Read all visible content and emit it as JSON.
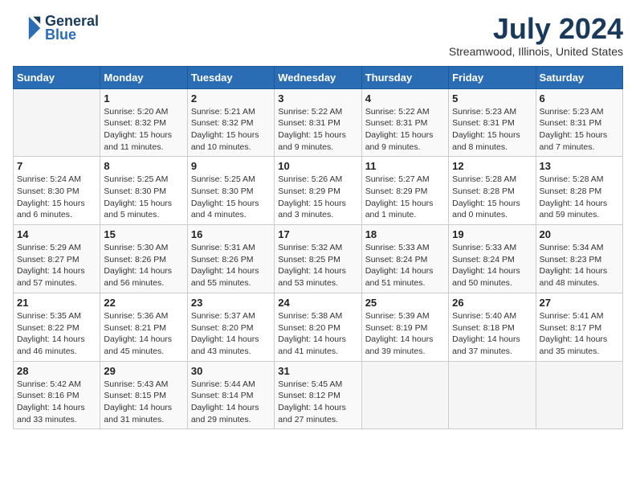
{
  "header": {
    "logo_line1": "General",
    "logo_line2": "Blue",
    "month_year": "July 2024",
    "location": "Streamwood, Illinois, United States"
  },
  "weekdays": [
    "Sunday",
    "Monday",
    "Tuesday",
    "Wednesday",
    "Thursday",
    "Friday",
    "Saturday"
  ],
  "weeks": [
    [
      {
        "day": "",
        "info": ""
      },
      {
        "day": "1",
        "info": "Sunrise: 5:20 AM\nSunset: 8:32 PM\nDaylight: 15 hours\nand 11 minutes."
      },
      {
        "day": "2",
        "info": "Sunrise: 5:21 AM\nSunset: 8:32 PM\nDaylight: 15 hours\nand 10 minutes."
      },
      {
        "day": "3",
        "info": "Sunrise: 5:22 AM\nSunset: 8:31 PM\nDaylight: 15 hours\nand 9 minutes."
      },
      {
        "day": "4",
        "info": "Sunrise: 5:22 AM\nSunset: 8:31 PM\nDaylight: 15 hours\nand 9 minutes."
      },
      {
        "day": "5",
        "info": "Sunrise: 5:23 AM\nSunset: 8:31 PM\nDaylight: 15 hours\nand 8 minutes."
      },
      {
        "day": "6",
        "info": "Sunrise: 5:23 AM\nSunset: 8:31 PM\nDaylight: 15 hours\nand 7 minutes."
      }
    ],
    [
      {
        "day": "7",
        "info": "Sunrise: 5:24 AM\nSunset: 8:30 PM\nDaylight: 15 hours\nand 6 minutes."
      },
      {
        "day": "8",
        "info": "Sunrise: 5:25 AM\nSunset: 8:30 PM\nDaylight: 15 hours\nand 5 minutes."
      },
      {
        "day": "9",
        "info": "Sunrise: 5:25 AM\nSunset: 8:30 PM\nDaylight: 15 hours\nand 4 minutes."
      },
      {
        "day": "10",
        "info": "Sunrise: 5:26 AM\nSunset: 8:29 PM\nDaylight: 15 hours\nand 3 minutes."
      },
      {
        "day": "11",
        "info": "Sunrise: 5:27 AM\nSunset: 8:29 PM\nDaylight: 15 hours\nand 1 minute."
      },
      {
        "day": "12",
        "info": "Sunrise: 5:28 AM\nSunset: 8:28 PM\nDaylight: 15 hours\nand 0 minutes."
      },
      {
        "day": "13",
        "info": "Sunrise: 5:28 AM\nSunset: 8:28 PM\nDaylight: 14 hours\nand 59 minutes."
      }
    ],
    [
      {
        "day": "14",
        "info": "Sunrise: 5:29 AM\nSunset: 8:27 PM\nDaylight: 14 hours\nand 57 minutes."
      },
      {
        "day": "15",
        "info": "Sunrise: 5:30 AM\nSunset: 8:26 PM\nDaylight: 14 hours\nand 56 minutes."
      },
      {
        "day": "16",
        "info": "Sunrise: 5:31 AM\nSunset: 8:26 PM\nDaylight: 14 hours\nand 55 minutes."
      },
      {
        "day": "17",
        "info": "Sunrise: 5:32 AM\nSunset: 8:25 PM\nDaylight: 14 hours\nand 53 minutes."
      },
      {
        "day": "18",
        "info": "Sunrise: 5:33 AM\nSunset: 8:24 PM\nDaylight: 14 hours\nand 51 minutes."
      },
      {
        "day": "19",
        "info": "Sunrise: 5:33 AM\nSunset: 8:24 PM\nDaylight: 14 hours\nand 50 minutes."
      },
      {
        "day": "20",
        "info": "Sunrise: 5:34 AM\nSunset: 8:23 PM\nDaylight: 14 hours\nand 48 minutes."
      }
    ],
    [
      {
        "day": "21",
        "info": "Sunrise: 5:35 AM\nSunset: 8:22 PM\nDaylight: 14 hours\nand 46 minutes."
      },
      {
        "day": "22",
        "info": "Sunrise: 5:36 AM\nSunset: 8:21 PM\nDaylight: 14 hours\nand 45 minutes."
      },
      {
        "day": "23",
        "info": "Sunrise: 5:37 AM\nSunset: 8:20 PM\nDaylight: 14 hours\nand 43 minutes."
      },
      {
        "day": "24",
        "info": "Sunrise: 5:38 AM\nSunset: 8:20 PM\nDaylight: 14 hours\nand 41 minutes."
      },
      {
        "day": "25",
        "info": "Sunrise: 5:39 AM\nSunset: 8:19 PM\nDaylight: 14 hours\nand 39 minutes."
      },
      {
        "day": "26",
        "info": "Sunrise: 5:40 AM\nSunset: 8:18 PM\nDaylight: 14 hours\nand 37 minutes."
      },
      {
        "day": "27",
        "info": "Sunrise: 5:41 AM\nSunset: 8:17 PM\nDaylight: 14 hours\nand 35 minutes."
      }
    ],
    [
      {
        "day": "28",
        "info": "Sunrise: 5:42 AM\nSunset: 8:16 PM\nDaylight: 14 hours\nand 33 minutes."
      },
      {
        "day": "29",
        "info": "Sunrise: 5:43 AM\nSunset: 8:15 PM\nDaylight: 14 hours\nand 31 minutes."
      },
      {
        "day": "30",
        "info": "Sunrise: 5:44 AM\nSunset: 8:14 PM\nDaylight: 14 hours\nand 29 minutes."
      },
      {
        "day": "31",
        "info": "Sunrise: 5:45 AM\nSunset: 8:12 PM\nDaylight: 14 hours\nand 27 minutes."
      },
      {
        "day": "",
        "info": ""
      },
      {
        "day": "",
        "info": ""
      },
      {
        "day": "",
        "info": ""
      }
    ]
  ]
}
